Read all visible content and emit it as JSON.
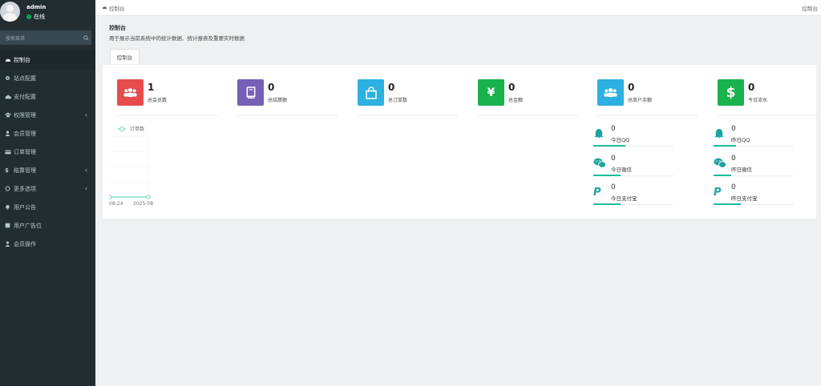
{
  "user": {
    "name": "admin",
    "status": "在线"
  },
  "sidebar": {
    "search_placeholder": "搜索菜单",
    "items": [
      {
        "label": "控制台",
        "icon": "dashboard-icon",
        "active": true
      },
      {
        "label": "站点配置",
        "icon": "gear-icon"
      },
      {
        "label": "支付配置",
        "icon": "cloud-icon"
      },
      {
        "label": "权限管理",
        "icon": "group-icon",
        "has_children": true
      },
      {
        "label": "会员管理",
        "icon": "user-icon"
      },
      {
        "label": "订单管理",
        "icon": "card-icon"
      },
      {
        "label": "结算管理",
        "icon": "dollar-icon",
        "has_children": true
      },
      {
        "label": "更多选项",
        "icon": "circle-icon",
        "has_children": true
      },
      {
        "label": "用户公告",
        "icon": "bell-icon"
      },
      {
        "label": "用户广告位",
        "icon": "square-icon"
      },
      {
        "label": "会员操作",
        "icon": "user-lock-icon"
      }
    ]
  },
  "topbar": {
    "breadcrumb": "控制台",
    "right_tab": "控制台"
  },
  "content_header": {
    "title": "控制台",
    "description": "用于展示当前系统中的统计数据、统计报表及重要实时数据",
    "tab": "控制台"
  },
  "stats": [
    {
      "value": "1",
      "label": "总会员数",
      "color": "#e74c4c",
      "icon": "users-icon"
    },
    {
      "value": "0",
      "label": "总结算额",
      "color": "#7560b8",
      "icon": "book-icon"
    },
    {
      "value": "0",
      "label": "总订单数",
      "color": "#2cb1e0",
      "icon": "shopping-bag-icon"
    },
    {
      "value": "0",
      "label": "总金额",
      "color": "#19b24d",
      "icon": "yen-icon",
      "glyph": "¥"
    },
    {
      "value": "0",
      "label": "总商户余额",
      "color": "#2cb1e0",
      "icon": "users-icon"
    },
    {
      "value": "0",
      "label": "今日流水",
      "color": "#19b24d",
      "icon": "dollar-icon",
      "glyph": "$"
    }
  ],
  "mini_stats": [
    {
      "value": "0",
      "label": "今日QQ",
      "icon": "qq-icon"
    },
    {
      "value": "0",
      "label": "昨日QQ",
      "icon": "qq-icon"
    },
    {
      "value": "0",
      "label": "今日微信",
      "icon": "wechat-icon"
    },
    {
      "value": "0",
      "label": "昨日微信",
      "icon": "wechat-icon"
    },
    {
      "value": "0",
      "label": "今日支付宝",
      "icon": "paypal-icon"
    },
    {
      "value": "0",
      "label": "昨日支付宝",
      "icon": "paypal-icon"
    }
  ],
  "chart_data": {
    "type": "line",
    "x": [
      "08-24",
      "2025-08"
    ],
    "series": [
      {
        "name": "订单数",
        "values": [
          0,
          0
        ]
      }
    ],
    "colors": {
      "series": "#6ad5c0"
    },
    "grid": true,
    "legend": "top"
  }
}
